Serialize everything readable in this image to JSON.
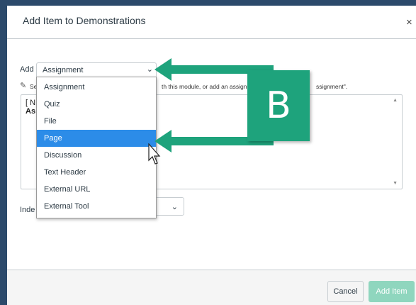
{
  "dialog": {
    "title": "Add Item to Demonstrations",
    "close_glyph": "×"
  },
  "form": {
    "add_label": "Add",
    "type_selected": "Assignment",
    "help_lead": "Se",
    "help_mid": "th this module, or add an assignm",
    "help_tail": "ssignment\".",
    "list_new": "[ N",
    "list_sub": "As",
    "indent_label": "Inde"
  },
  "dropdown": {
    "options": [
      "Assignment",
      "Quiz",
      "File",
      "Page",
      "Discussion",
      "Text Header",
      "External URL",
      "External Tool"
    ],
    "highlighted": "Page"
  },
  "footer": {
    "cancel_label": "Cancel",
    "add_item_label": "Add Item"
  },
  "annotation": {
    "badge_letter": "B",
    "badge_color": "#1ea37c",
    "arrow_color": "#1ea37c"
  },
  "colors": {
    "highlight": "#2c8ce8",
    "add_item_button": "#8fd6be",
    "frame": "#2c4a6b"
  }
}
